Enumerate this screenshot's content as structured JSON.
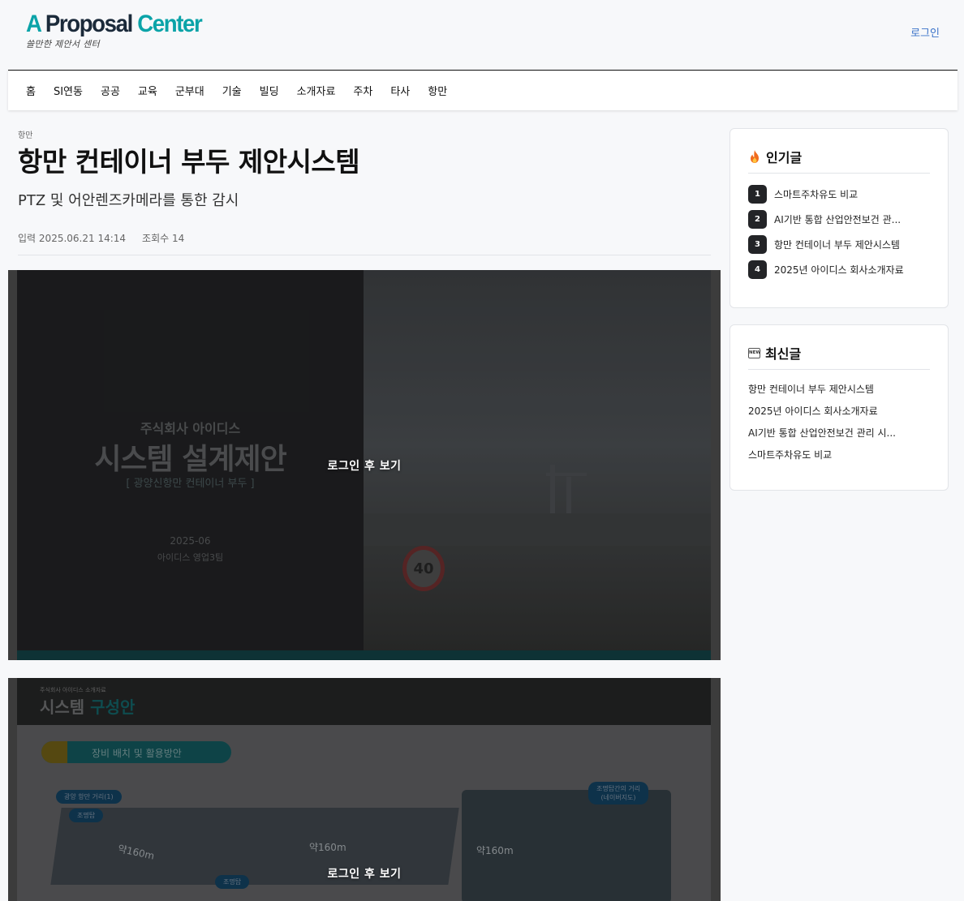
{
  "header": {
    "logo_a": "A",
    "logo_proposal": "Proposal",
    "logo_center": "Center",
    "logo_sub": "쓸만한 제안서 센터",
    "login": "로그인"
  },
  "nav": {
    "items": [
      "홈",
      "SI연동",
      "공공",
      "교육",
      "군부대",
      "기술",
      "빌딩",
      "소개자료",
      "주차",
      "타사",
      "항만"
    ]
  },
  "article": {
    "category": "항만",
    "title": "항만 컨테이너 부두 제안시스템",
    "subtitle": "PTZ 및 어안렌즈카메라를 통한 감시",
    "input_label": "입력",
    "input_date": "2025.06.21 14:14",
    "views_label": "조회수",
    "views": "14"
  },
  "slides": [
    {
      "lock_text": "로그인 후 보기",
      "company": "주식회사 아이디스",
      "title": "시스템 설계제안",
      "subtitle": "[ 광양신항만 컨테이너 부두 ]",
      "date": "2025-06",
      "team": "아이디스 영업3팀",
      "sign": "40"
    },
    {
      "lock_text": "로그인 후 보기",
      "small_header": "주식회사 아이디스 소개자료",
      "heading_a": "시스템",
      "heading_b": "구성안",
      "pill": "장비 배치 및 활용방안",
      "tag_left": "광양 항만 거리(1)",
      "tag_right_1": "조명탑간의 거리",
      "tag_right_2": "(네이버지도)",
      "tag_light_1": "조명탑",
      "tag_light_2": "조명탑",
      "dist_1": "약160m",
      "dist_2": "약160m",
      "dist_3": "약160m"
    }
  ],
  "sidebar": {
    "popular_title": "인기글",
    "popular": [
      {
        "rank": "1",
        "label": "스마트주차유도 비교"
      },
      {
        "rank": "2",
        "label": "AI기반 통합 산업안전보건 관..."
      },
      {
        "rank": "3",
        "label": "항만 컨테이너 부두 제안시스템"
      },
      {
        "rank": "4",
        "label": "2025년 아이디스 회사소개자료"
      }
    ],
    "latest_title": "최신글",
    "latest_icon_text": "NEW",
    "latest": [
      "항만 컨테이너 부두 제안시스템",
      "2025년 아이디스 회사소개자료",
      "AI기반 통합 산업안전보건 관리 시...",
      "스마트주차유도 비교"
    ]
  }
}
